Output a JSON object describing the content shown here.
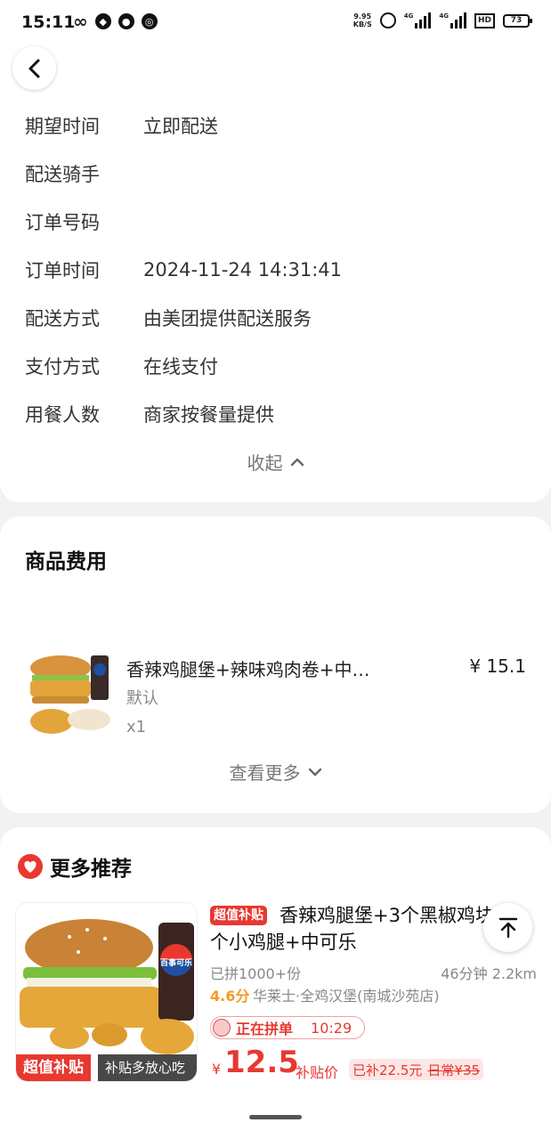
{
  "status_bar": {
    "time": "15:11",
    "net_speed_top": "9.95",
    "net_speed_bottom": "KB/S",
    "signal1": "4G",
    "signal2": "4G",
    "hd": "HD",
    "battery": "73"
  },
  "order_info": {
    "rows": [
      {
        "label": "期望时间",
        "value": "立即配送"
      },
      {
        "label": "配送骑手",
        "value": ""
      },
      {
        "label": "订单号码",
        "value": ""
      },
      {
        "label": "订单时间",
        "value": "2024-11-24 14:31:41"
      },
      {
        "label": "配送方式",
        "value": "由美团提供配送服务"
      },
      {
        "label": "支付方式",
        "value": "在线支付"
      },
      {
        "label": "用餐人数",
        "value": "商家按餐量提供"
      }
    ],
    "collapse_label": "收起"
  },
  "goods": {
    "title": "商品费用",
    "item": {
      "name": "香辣鸡腿堡+辣味鸡肉卷+中…",
      "price": "¥ 15.1",
      "spec": "默认",
      "qty": "x1"
    },
    "more_label": "查看更多"
  },
  "recommend": {
    "title": "更多推荐",
    "tag": "超值补贴",
    "name": "香辣鸡腿堡+3个黑椒鸡块+1个小鸡腿+中可乐",
    "sold": "已拼1000+份",
    "eta_distance": "46分钟  2.2km",
    "score": "4.6分",
    "shop": "华莱士·全鸡汉堡(南城沙苑店)",
    "group_label": "正在拼单",
    "group_time": "10:29",
    "yen": "¥",
    "price": "12.5",
    "price_note": "补贴价",
    "subsidy": "已补22.5元",
    "original": "日常¥35",
    "img_badge_a": "超值补贴",
    "img_badge_b": "补贴多放心吃",
    "cola_label": "百事可乐"
  },
  "colors": {
    "accent_red": "#e8382f",
    "score_orange": "#f59a23"
  }
}
